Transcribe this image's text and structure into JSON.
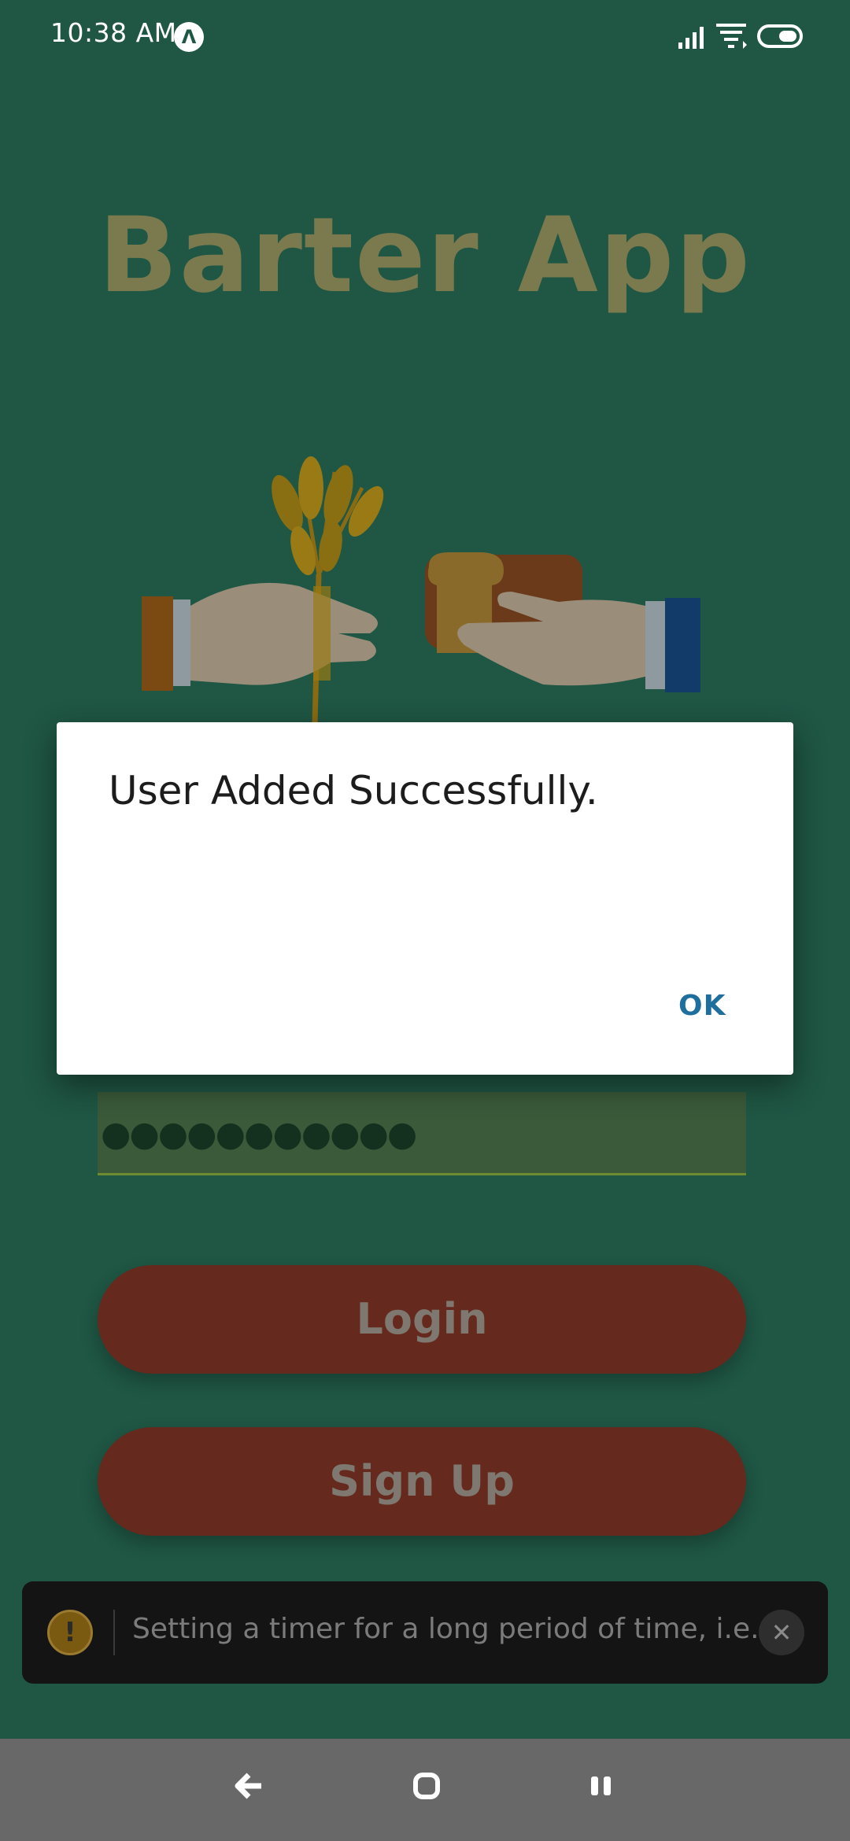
{
  "status_bar": {
    "time": "10:38 AM",
    "badge_icon": "expo-logo-icon",
    "icons": [
      "signal-icon",
      "wifi-icon",
      "battery-toggle-icon"
    ]
  },
  "app": {
    "title": "Barter App",
    "illustration": "hands-exchanging-wheat-and-bread"
  },
  "form": {
    "password_mask": "●●●●●●●●●●●"
  },
  "buttons": {
    "login_label": "Login",
    "signup_label": "Sign Up"
  },
  "dialog": {
    "message": "User Added Successfully.",
    "ok_label": "OK"
  },
  "toast": {
    "icon_glyph": "!",
    "message": "Setting a timer for a long period of time, i.e....",
    "close_glyph": "✕"
  },
  "colors": {
    "background": "#1f5644",
    "title": "#7a7a4e",
    "button": "#652a1d",
    "dialog_accent": "#1e6e9e"
  }
}
